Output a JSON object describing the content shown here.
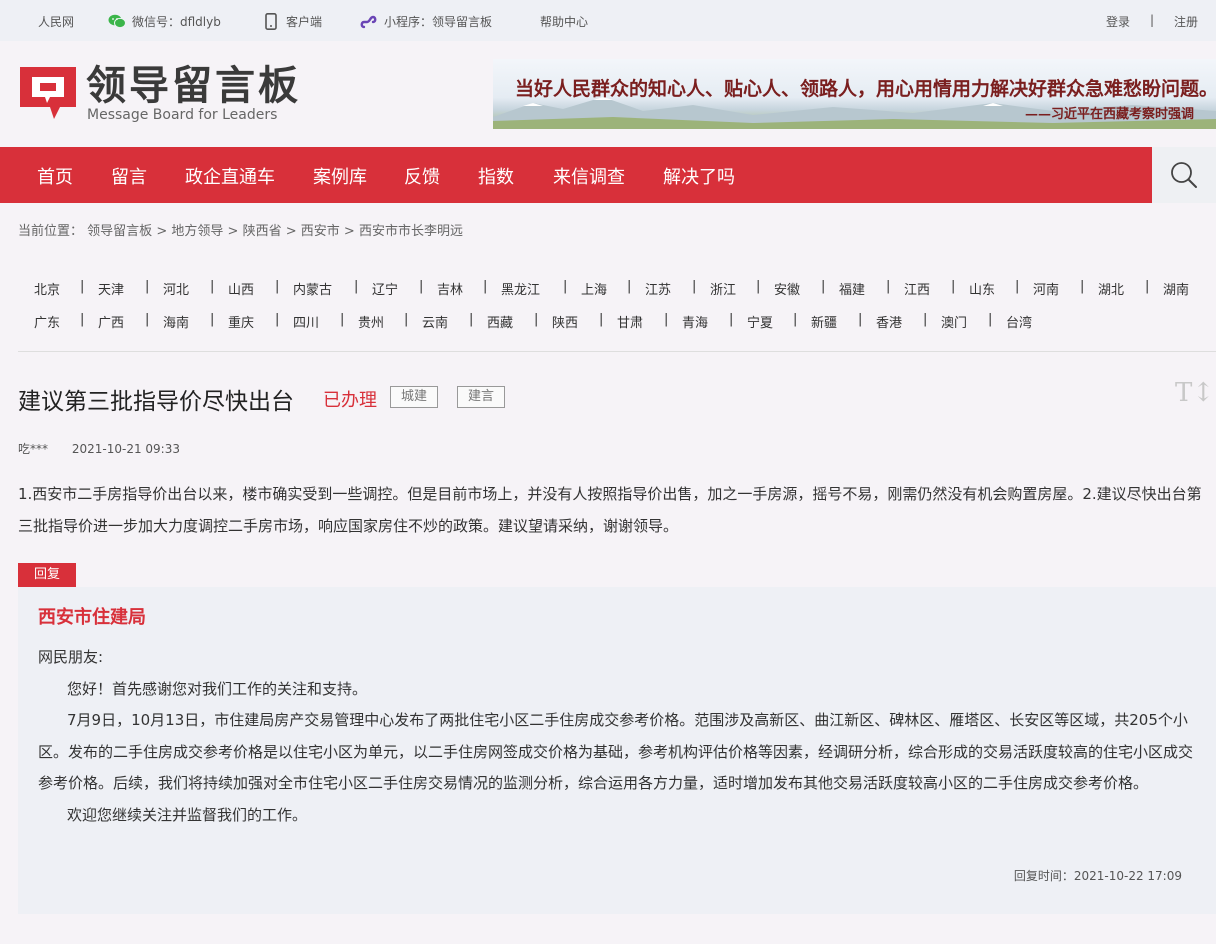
{
  "topbar": {
    "site": "人民网",
    "wechat": "微信号：dfldlyb",
    "client": "客户端",
    "miniapp": "小程序：领导留言板",
    "help": "帮助中心",
    "login": "登录",
    "divider": "|",
    "register": "注册"
  },
  "header": {
    "logo_cn": "领导留言板",
    "logo_en": "Message Board for Leaders",
    "banner_line1": "当好人民群众的知心人、贴心人、领路人，用心用情用力解决好群众急难愁盼问题。",
    "banner_line2": "——习近平在西藏考察时强调"
  },
  "nav": [
    "首页",
    "留言",
    "政企直通车",
    "案例库",
    "反馈",
    "指数",
    "来信调查",
    "解决了吗"
  ],
  "breadcrumb": {
    "prefix": "当前位置：",
    "items": [
      "领导留言板",
      "地方领导",
      "陕西省",
      "西安市",
      "西安市市长李明远"
    ],
    "sep": ">"
  },
  "provinces": {
    "row1": [
      "北京",
      "天津",
      "河北",
      "山西",
      "内蒙古",
      "辽宁",
      "吉林",
      "黑龙江",
      "上海",
      "江苏",
      "浙江",
      "安徽",
      "福建",
      "江西",
      "山东",
      "河南",
      "湖北",
      "湖南"
    ],
    "row2": [
      "广东",
      "广西",
      "海南",
      "重庆",
      "四川",
      "贵州",
      "云南",
      "西藏",
      "陕西",
      "甘肃",
      "青海",
      "宁夏",
      "新疆",
      "香港",
      "澳门",
      "台湾"
    ],
    "sep": "|"
  },
  "message": {
    "title": "建议第三批指导价尽快出台",
    "status": "已办理",
    "tags": [
      "城建",
      "建言"
    ],
    "font_icon": "T↕",
    "author": "吃***",
    "time": "2021-10-21 09:33",
    "content": "1.西安市二手房指导价出台以来，楼市确实受到一些调控。但是目前市场上，并没有人按照指导价出售，加之一手房源，摇号不易，刚需仍然没有机会购置房屋。2.建议尽快出台第三批指导价进一步加大力度调控二手房市场，响应国家房住不炒的政策。建议望请采纳，谢谢领导。"
  },
  "reply": {
    "label": "回复",
    "org": "西安市住建局",
    "greeting": "网民朋友:",
    "p1": "您好！首先感谢您对我们工作的关注和支持。",
    "p2": "7月9日，10月13日，市住建局房产交易管理中心发布了两批住宅小区二手住房成交参考价格。范围涉及高新区、曲江新区、碑林区、雁塔区、长安区等区域，共205个小区。发布的二手住房成交参考价格是以住宅小区为单元，以二手住房网签成交价格为基础，参考机构评估价格等因素，经调研分析，综合形成的交易活跃度较高的住宅小区成交参考价格。后续，我们将持续加强对全市住宅小区二手住房交易情况的监测分析，综合运用各方力量，适时增加发布其他交易活跃度较高小区的二手住房成交参考价格。",
    "p3": "欢迎您继续关注并监督我们的工作。",
    "time": "回复时间：2021-10-22 17:09"
  },
  "colors": {
    "brand": "#d8303a",
    "topbar": "#eef0f5",
    "page": "#f6f3f7"
  }
}
